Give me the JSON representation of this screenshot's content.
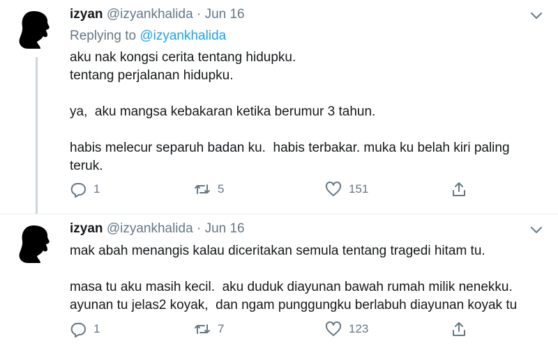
{
  "tweets": [
    {
      "name": "izyan",
      "handle": "@izyankhalida",
      "separator": "·",
      "date": "Jun 16",
      "replying_prefix": "Replying to ",
      "replying_to": "@izyankhalida",
      "text": "aku nak kongsi cerita tentang hidupku.\ntentang perjalanan hidupku.\n\nya,  aku mangsa kebakaran ketika berumur 3 tahun.\n\nhabis melecur separuh badan ku.  habis terbakar. muka ku belah kiri paling\nteruk.",
      "replies": "1",
      "retweets": "5",
      "likes": "151"
    },
    {
      "name": "izyan",
      "handle": "@izyankhalida",
      "separator": "·",
      "date": "Jun 16",
      "text": "mak abah menangis kalau diceritakan semula tentang tragedi hitam tu.\n\nmasa tu aku masih kecil.  aku duduk diayunan bawah rumah milik nenekku.\nayunan tu jelas2 koyak,  dan ngam punggungku berlabuh diayunan koyak tu",
      "replies": "1",
      "retweets": "7",
      "likes": "123"
    }
  ],
  "icons": {
    "avatar": "woman-silhouette-avatar",
    "reply": "reply-icon",
    "retweet": "retweet-icon",
    "like": "heart-icon",
    "share": "share-icon",
    "more": "chevron-down-icon"
  },
  "colors": {
    "text": "#14171a",
    "muted": "#657786",
    "link": "#1da1f2",
    "divider": "#e6ecf0",
    "thread": "#ccd6dd"
  }
}
